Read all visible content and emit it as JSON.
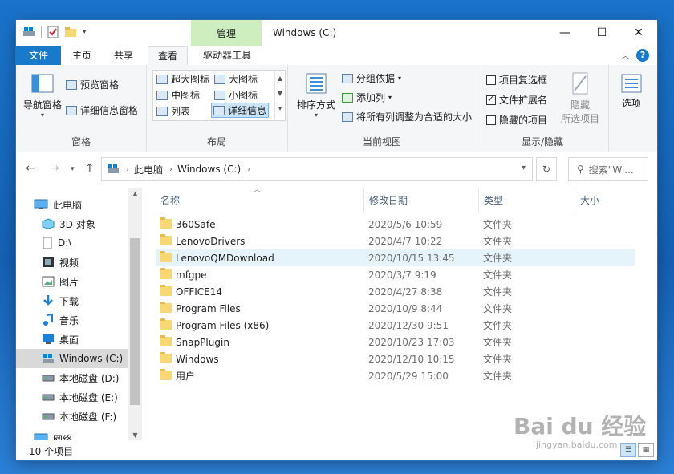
{
  "window": {
    "title": "Windows (C:)",
    "contextual_tab": "管理",
    "caption": {
      "minimize": "—",
      "maximize": "☐",
      "close": "✕"
    }
  },
  "tabs": {
    "file": "文件",
    "home": "主页",
    "share": "共享",
    "view": "查看",
    "drive_tools": "驱动器工具"
  },
  "ribbon": {
    "panes": {
      "nav_pane": "导航窗格",
      "preview_pane": "预览窗格",
      "details_pane": "详细信息窗格",
      "label": "窗格"
    },
    "layout": {
      "items": [
        "超大图标",
        "大图标",
        "中图标",
        "小图标",
        "列表",
        "详细信息"
      ],
      "label": "布局"
    },
    "current_view": {
      "sort_by": "排序方式",
      "group_by": "分组依据",
      "add_column": "添加列",
      "fit_columns": "将所有列调整为合适的大小",
      "label": "当前视图"
    },
    "show_hide": {
      "item_checkboxes": "项目复选框",
      "file_extensions": "文件扩展名",
      "hidden_items": "隐藏的项目",
      "hide_selected_1": "隐藏",
      "hide_selected_2": "所选项目",
      "label": "显示/隐藏",
      "file_extensions_checked": true,
      "item_checkboxes_checked": false,
      "hidden_items_checked": false
    },
    "options": "选项"
  },
  "address": {
    "crumbs": [
      "此电脑",
      "Windows (C:)"
    ],
    "search_placeholder": "搜索\"Wi..."
  },
  "nav": {
    "items": [
      {
        "label": "此电脑",
        "icon": "computer-icon"
      },
      {
        "label": "3D 对象",
        "icon": "cube-icon"
      },
      {
        "label": "D:\\",
        "icon": "document-icon"
      },
      {
        "label": "视频",
        "icon": "video-icon"
      },
      {
        "label": "图片",
        "icon": "picture-icon"
      },
      {
        "label": "下载",
        "icon": "download-icon"
      },
      {
        "label": "音乐",
        "icon": "music-icon"
      },
      {
        "label": "桌面",
        "icon": "desktop-icon"
      },
      {
        "label": "Windows (C:)",
        "icon": "system-drive-icon"
      },
      {
        "label": "本地磁盘 (D:)",
        "icon": "drive-icon"
      },
      {
        "label": "本地磁盘 (E:)",
        "icon": "drive-icon"
      },
      {
        "label": "本地磁盘 (F:)",
        "icon": "drive-icon"
      },
      {
        "label": "网络",
        "icon": "network-icon"
      }
    ]
  },
  "columns": {
    "name": "名称",
    "date": "修改日期",
    "type": "类型",
    "size": "大小"
  },
  "files": [
    {
      "name": "360Safe",
      "date": "2020/5/6 10:59",
      "type": "文件夹"
    },
    {
      "name": "LenovoDrivers",
      "date": "2020/4/7 10:22",
      "type": "文件夹"
    },
    {
      "name": "LenovoQMDownload",
      "date": "2020/10/15 13:45",
      "type": "文件夹"
    },
    {
      "name": "mfgpe",
      "date": "2020/3/7 9:19",
      "type": "文件夹"
    },
    {
      "name": "OFFICE14",
      "date": "2020/4/27 8:38",
      "type": "文件夹"
    },
    {
      "name": "Program Files",
      "date": "2020/10/9 8:44",
      "type": "文件夹"
    },
    {
      "name": "Program Files (x86)",
      "date": "2020/12/30 9:51",
      "type": "文件夹"
    },
    {
      "name": "SnapPlugin",
      "date": "2020/10/23 17:03",
      "type": "文件夹"
    },
    {
      "name": "Windows",
      "date": "2020/12/10 10:15",
      "type": "文件夹"
    },
    {
      "name": "用户",
      "date": "2020/5/29 15:00",
      "type": "文件夹"
    }
  ],
  "status": {
    "count": "10 个项目"
  },
  "watermark": {
    "main": "Bai du 经验",
    "sub": "jingyan.baidu.com"
  }
}
